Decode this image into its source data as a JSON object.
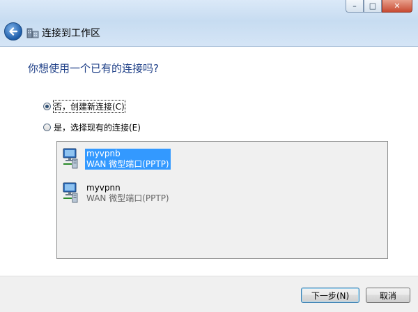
{
  "window": {
    "title": "连接到工作区",
    "controls": {
      "minimize": "–",
      "maximize": "□",
      "close": "✕"
    }
  },
  "page": {
    "question": "你想使用一个已有的连接吗?"
  },
  "options": [
    {
      "label": "否，创建新连接(C)",
      "selected": true
    },
    {
      "label": "是，选择现有的连接(E)",
      "selected": false
    }
  ],
  "connections": [
    {
      "name": "myvpnb",
      "type": "WAN 微型端口(PPTP)",
      "selected": true
    },
    {
      "name": "myvpnn",
      "type": "WAN 微型端口(PPTP)",
      "selected": false
    }
  ],
  "footer": {
    "next_label": "下一步(N)",
    "cancel_label": "取消"
  },
  "colors": {
    "heading_blue": "#1e3f87",
    "selection_blue": "#3399ff"
  }
}
